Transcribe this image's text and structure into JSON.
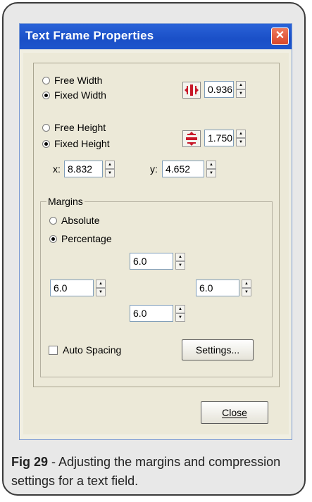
{
  "window": {
    "title": "Text Frame Properties",
    "close_glyph": "✕"
  },
  "width": {
    "free_label": "Free Width",
    "fixed_label": "Fixed Width",
    "selected": "Fixed Width",
    "value": "0.936"
  },
  "height": {
    "free_label": "Free Height",
    "fixed_label": "Fixed Height",
    "selected": "Fixed Height",
    "value": "1.750"
  },
  "position": {
    "x_label": "x:",
    "x_value": "8.832",
    "y_label": "y:",
    "y_value": "4.652"
  },
  "margins": {
    "group_label": "Margins",
    "absolute_label": "Absolute",
    "percentage_label": "Percentage",
    "selected": "Percentage",
    "top": "6.0",
    "left": "6.0",
    "right": "6.0",
    "bottom": "6.0"
  },
  "auto_spacing": {
    "label": "Auto Spacing",
    "checked": false
  },
  "buttons": {
    "settings": "Settings...",
    "close": "Close"
  },
  "caption": {
    "fig": "Fig 29",
    "text": " - Adjusting the margins and compression settings for a text field."
  },
  "colors": {
    "titlebar": "#1a4fc7",
    "dialog_bg": "#ece9d8",
    "close_red": "#d9462a",
    "icon_red": "#c8192a"
  },
  "icons": [
    "close-icon",
    "fixed-width-icon",
    "fixed-height-icon",
    "spin-up-icon",
    "spin-down-icon"
  ]
}
